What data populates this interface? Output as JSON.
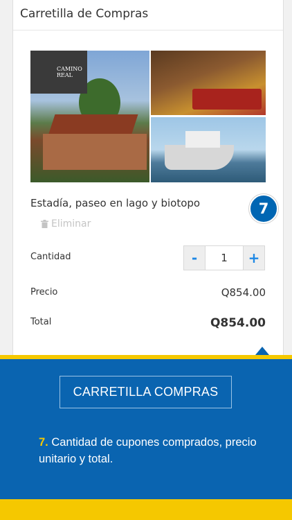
{
  "cart": {
    "title": "Carretilla de Compras",
    "product_title": "Estadía, paseo en lago y biotopo",
    "photo_logo_text": "CAMINO REAL",
    "remove_label": "Eliminar",
    "quantity_label": "Cantidad",
    "quantity_value": "1",
    "decrement_label": "-",
    "increment_label": "+",
    "price_label": "Precio",
    "price_value": "Q854.00",
    "total_label": "Total",
    "total_value": "Q854.00"
  },
  "tutorial": {
    "step_number": "7",
    "cta_label": "CARRETILLA COMPRAS",
    "note_number": "7.",
    "note_text": "Cantidad de cupones comprados, precio unitario y total."
  },
  "colors": {
    "primary_blue": "#0a64b0",
    "accent_yellow": "#f5c800",
    "stepper_blue": "#1e88e5"
  },
  "icons": {
    "remove": "trash-icon"
  }
}
